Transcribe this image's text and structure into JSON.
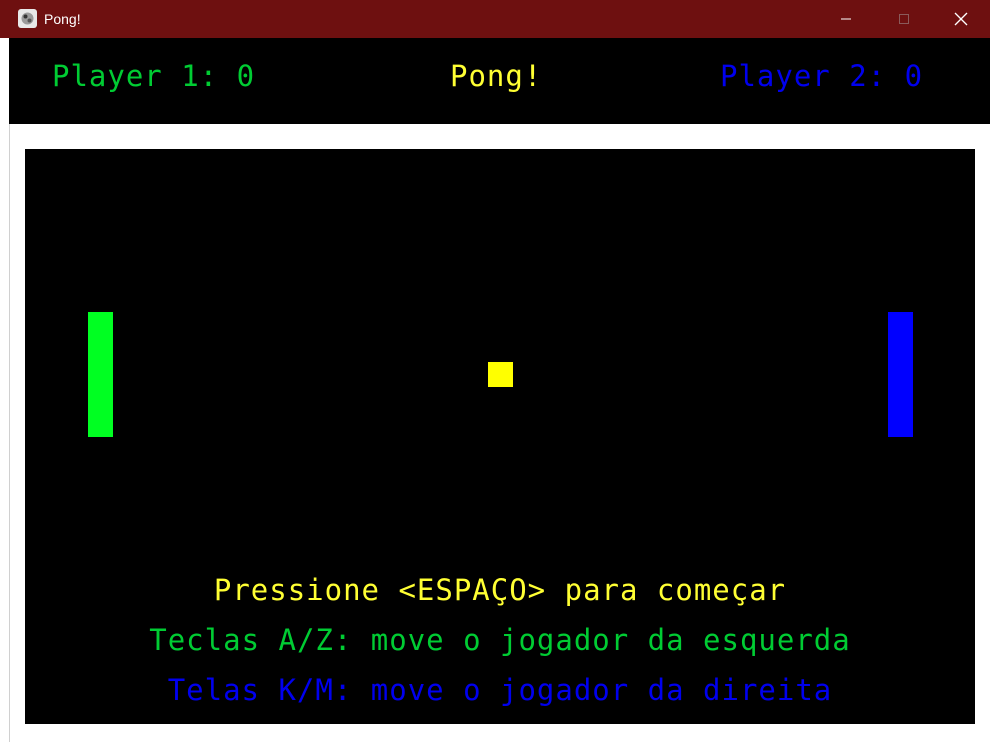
{
  "window": {
    "title": "Pong!",
    "titlebar_color": "#6e1010",
    "controls": {
      "minimize_icon": "minimize-icon",
      "maximize_icon": "maximize-icon",
      "close_icon": "close-icon"
    }
  },
  "scoreboard": {
    "player1": "Player 1: 0",
    "title": "Pong!",
    "player2": "Player 2: 0",
    "colors": {
      "player1": "#00cc33",
      "title": "#ffff33",
      "player2": "#0000ee"
    }
  },
  "court": {
    "background": "#000000",
    "left_paddle_color": "#00ff22",
    "right_paddle_color": "#0000ff",
    "ball_color": "#ffff00"
  },
  "messages": {
    "start": "Pressione <ESPAÇO> para começar",
    "left_controls": "Teclas A/Z: move o jogador da esquerda",
    "right_controls": "Telas K/M: move o jogador da direita"
  }
}
